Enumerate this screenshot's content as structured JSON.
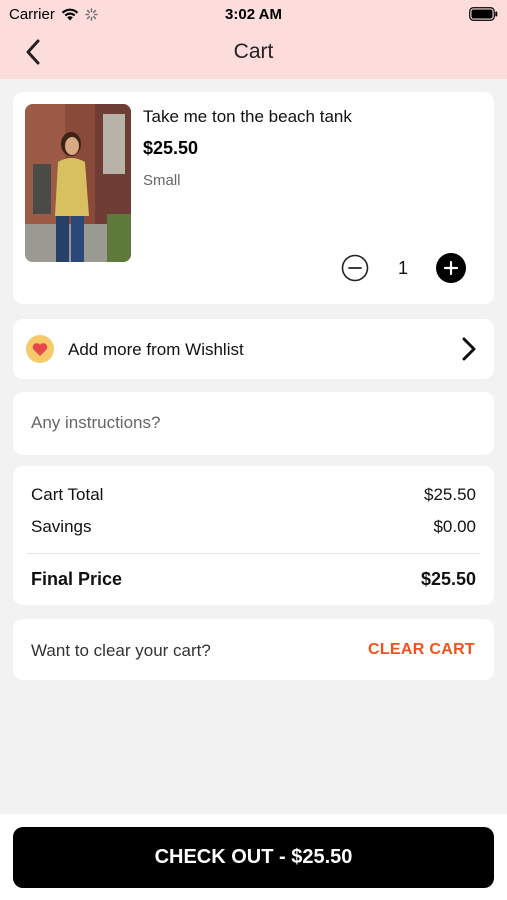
{
  "status_bar": {
    "carrier": "Carrier",
    "time": "3:02 AM"
  },
  "header": {
    "title": "Cart"
  },
  "cart_item": {
    "name": "Take me ton the beach tank",
    "price": "$25.50",
    "size": "Small",
    "quantity": "1"
  },
  "wishlist": {
    "label": "Add more from Wishlist"
  },
  "instructions": {
    "placeholder": "Any instructions?"
  },
  "summary": {
    "cart_total_label": "Cart Total",
    "cart_total_value": "$25.50",
    "savings_label": "Savings",
    "savings_value": "$0.00",
    "final_price_label": "Final Price",
    "final_price_value": "$25.50"
  },
  "clear_cart": {
    "question": "Want to clear your cart?",
    "button_label": "CLEAR CART"
  },
  "checkout": {
    "label": "CHECK OUT - $25.50"
  },
  "colors": {
    "header_bg": "#fddcdc",
    "accent": "#f2511b",
    "checkout_bg": "#000000",
    "heart": "#e8474a",
    "heart_bg": "#f6c96a"
  },
  "icons": [
    "wifi-icon",
    "activity-spinner-icon",
    "battery-icon",
    "back-arrow-icon",
    "minus-circle-icon",
    "plus-circle-icon",
    "heart-icon",
    "chevron-right-icon"
  ]
}
